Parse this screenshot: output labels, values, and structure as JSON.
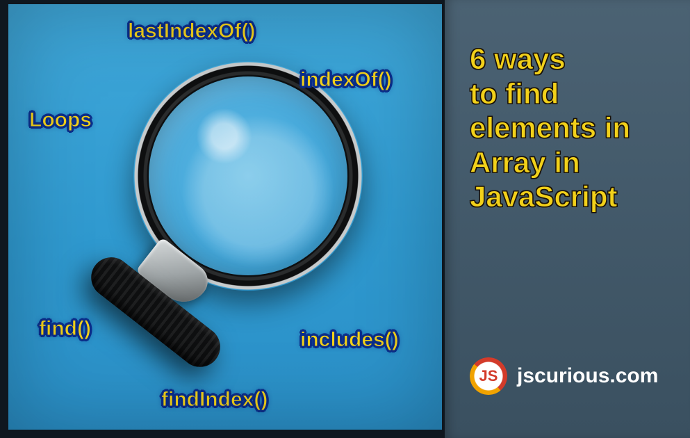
{
  "methods": {
    "lastIndexOf": "lastIndexOf()",
    "indexOf": "indexOf()",
    "loops": "Loops",
    "find": "find()",
    "includes": "includes()",
    "findIndex": "findIndex()"
  },
  "title": {
    "line1": "6 ways",
    "line2": "to find",
    "line3": "elements in",
    "line4": "Array in",
    "line5": "JavaScript"
  },
  "site": {
    "logo_text": "JS",
    "name": "jscurious.com"
  }
}
